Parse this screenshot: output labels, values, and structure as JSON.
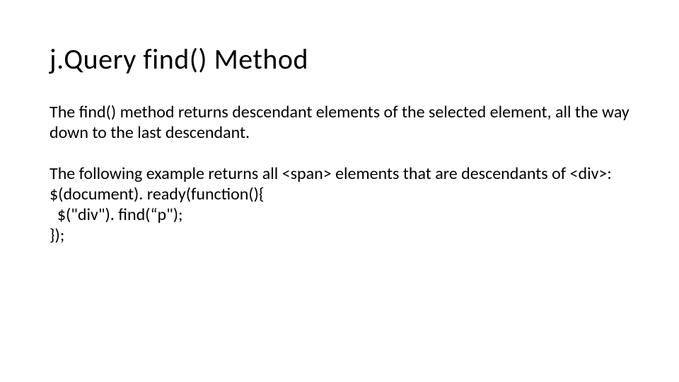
{
  "title": "j.Query find() Method",
  "para1": "The find() method returns descendant elements of the selected element, all the way down to the last descendant.",
  "para2": "The following example returns all <span> elements that are descendants of <div>:",
  "code": {
    "line1": "$(document). ready(function(){",
    "line2": "  $(\"div\"). find(“p\");",
    "line3": "});"
  }
}
